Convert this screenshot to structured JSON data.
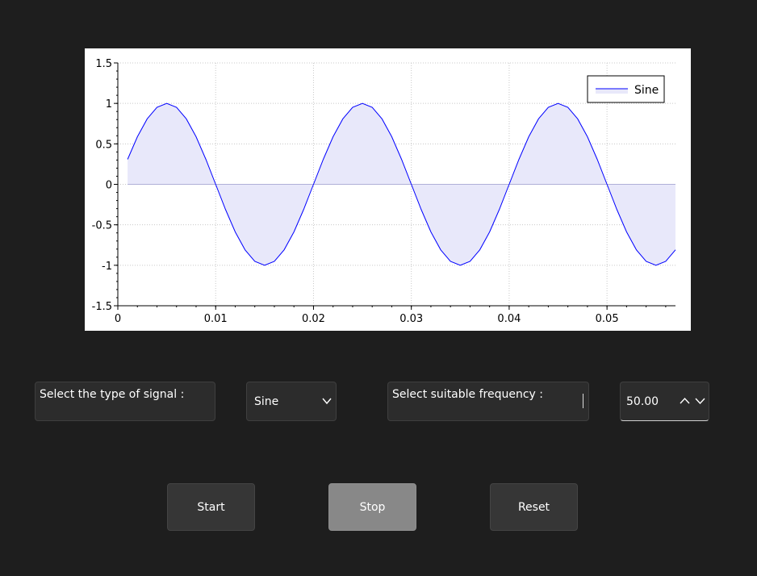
{
  "chart_data": {
    "type": "area",
    "series": [
      {
        "name": "Sine",
        "line_color": "#0000ff",
        "fill_color": "#e8e8fa",
        "frequency_hz": 50,
        "x_start": 0.001,
        "x_end": 0.057,
        "x_step": 0.001
      }
    ],
    "xlim": [
      0,
      0.057
    ],
    "ylim": [
      -1.5,
      1.5
    ],
    "x_ticks": [
      "0",
      "0.01",
      "0.02",
      "0.03",
      "0.04",
      "0.05"
    ],
    "y_ticks": [
      "1.5",
      "1",
      "0.5",
      "0",
      "-0.5",
      "-1",
      "-1.5"
    ],
    "grid": true,
    "legend_position": "top-right",
    "legend_label": "Sine"
  },
  "controls": {
    "signal_type_label": "Select the type of signal :",
    "signal_type_value": "Sine",
    "frequency_label": "Select suitable frequency :",
    "frequency_value": "50.00"
  },
  "buttons": {
    "start": "Start",
    "stop": "Stop",
    "reset": "Reset"
  },
  "colors": {
    "background": "#1e1e1e",
    "panel": "#2c2c2c",
    "button": "#363636",
    "stop_button": "#888888",
    "series_line": "#0000ff",
    "series_fill": "#e8e8fa"
  }
}
